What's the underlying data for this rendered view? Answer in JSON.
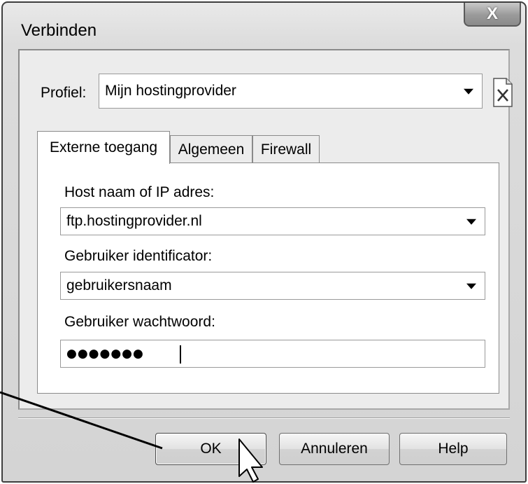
{
  "window": {
    "title": "Verbinden",
    "close_glyph": "X"
  },
  "profile": {
    "label": "Profiel:",
    "value": "Mijn hostingprovider",
    "delete_icon": "document-delete-icon"
  },
  "tabs": [
    {
      "label": "Externe toegang",
      "active": true
    },
    {
      "label": "Algemeen",
      "active": false
    },
    {
      "label": "Firewall",
      "active": false
    }
  ],
  "fields": {
    "host_label": "Host naam of IP adres:",
    "host_value": "ftp.hostingprovider.nl",
    "user_label": "Gebruiker identificator:",
    "user_value": "gebruikersnaam",
    "password_label": "Gebruiker wachtwoord:",
    "password_masked": "●●●●●●●"
  },
  "buttons": {
    "ok": "OK",
    "cancel": "Annuleren",
    "help": "Help"
  }
}
